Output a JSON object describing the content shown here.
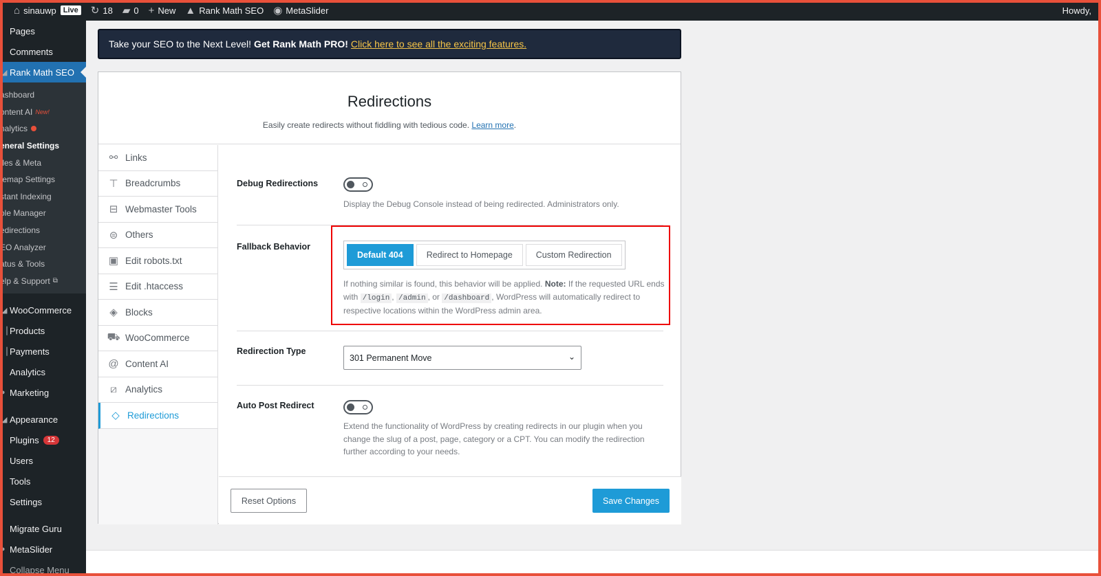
{
  "adminbar": {
    "site_name": "sinauwp",
    "live_badge": "Live",
    "updates_count": "18",
    "comments_count": "0",
    "new_label": "New",
    "rankmath_label": "Rank Math SEO",
    "metaslider_label": "MetaSlider",
    "howdy": "Howdy,"
  },
  "sidebar": {
    "top_items": [
      "Pages",
      "Comments"
    ],
    "active_item": "Rank Math SEO",
    "submenu": [
      "ashboard",
      "ontent AI",
      "nalytics",
      "eneral Settings",
      "tles & Meta",
      "temap Settings",
      "stant Indexing",
      "ole Manager",
      "edirections",
      "EO Analyzer",
      "atus & Tools",
      "elp & Support"
    ],
    "new_tag": "New!",
    "bottom_items": [
      "WooCommerce",
      "Products",
      "Payments",
      "Analytics",
      "Marketing",
      "Appearance",
      "Plugins",
      "Users",
      "Tools",
      "Settings",
      "Migrate Guru",
      "MetaSlider",
      "Collapse Menu"
    ],
    "plugins_badge": "12"
  },
  "promo": {
    "text": "Take your SEO to the Next Level!",
    "bold": "Get Rank Math PRO!",
    "link": "Click here to see all the exciting features."
  },
  "page": {
    "title": "Redirections",
    "subtitle": "Easily create redirects without fiddling with tedious code.",
    "learn_more": "Learn more",
    "period": "."
  },
  "tabs": [
    "Links",
    "Breadcrumbs",
    "Webmaster Tools",
    "Others",
    "Edit robots.txt",
    "Edit .htaccess",
    "Blocks",
    "WooCommerce",
    "Content AI",
    "Analytics",
    "Redirections"
  ],
  "settings": {
    "debug": {
      "label": "Debug Redirections",
      "desc": "Display the Debug Console instead of being redirected. Administrators only."
    },
    "fallback": {
      "label": "Fallback Behavior",
      "options": [
        "Default 404",
        "Redirect to Homepage",
        "Custom Redirection"
      ],
      "selected": "Default 404",
      "desc_1": "If nothing similar is found, this behavior will be applied.",
      "note_label": "Note:",
      "desc_2": "If the requested URL ends with",
      "code_1": "/login",
      "code_2": "/admin",
      "or": ", or",
      "code_3": "/dashboard",
      "desc_3": ", WordPress will automatically redirect to respective locations within the WordPress admin area."
    },
    "redirection_type": {
      "label": "Redirection Type",
      "value": "301 Permanent Move"
    },
    "auto_post": {
      "label": "Auto Post Redirect",
      "desc": "Extend the functionality of WordPress by creating redirects in our plugin when you change the slug of a post, page, category or a CPT. You can modify the redirection further according to your needs."
    }
  },
  "footer": {
    "reset": "Reset Options",
    "save": "Save Changes"
  },
  "colors": {
    "accent": "#1e9bd7",
    "admin_dark": "#1d2327",
    "highlight": "#ee0000"
  }
}
